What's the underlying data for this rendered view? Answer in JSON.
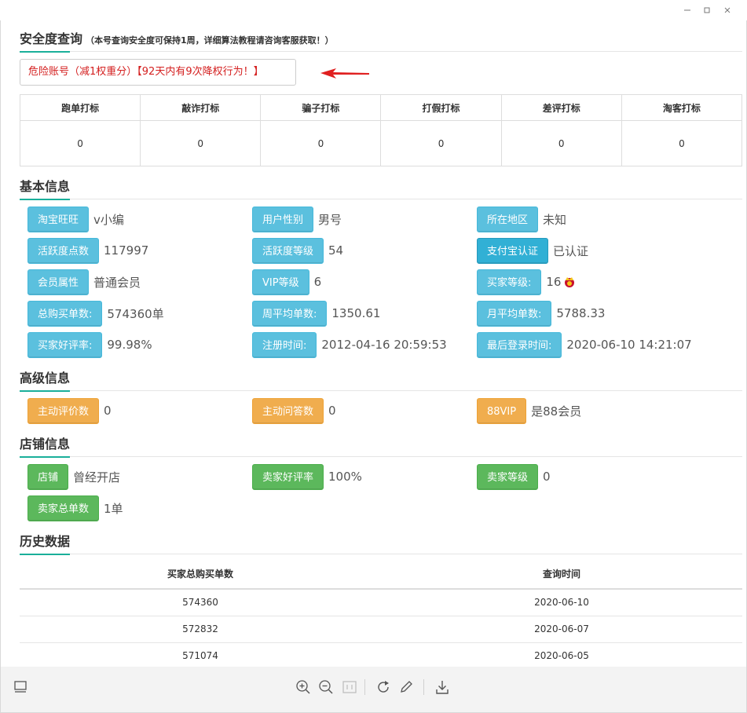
{
  "security": {
    "title": "安全度查询",
    "subtitle": "（本号查询安全度可保持1周，详细算法教程请咨询客服获取！）",
    "alert": "危险账号（减1权重分）【92天内有9次降权行为！】",
    "marks_headers": [
      "跑单打标",
      "敲诈打标",
      "骗子打标",
      "打假打标",
      "差评打标",
      "淘客打标"
    ],
    "marks_values": [
      "0",
      "0",
      "0",
      "0",
      "0",
      "0"
    ]
  },
  "basic": {
    "title": "基本信息",
    "rows": [
      [
        {
          "label": "淘宝旺旺",
          "value": "v小编"
        },
        {
          "label": "用户性别",
          "value": "男号"
        },
        {
          "label": "所在地区",
          "value": "未知"
        }
      ],
      [
        {
          "label": "活跃度点数",
          "value": "117997"
        },
        {
          "label": "活跃度等级",
          "value": "54"
        },
        {
          "label": "支付宝认证",
          "value": "已认证"
        }
      ],
      [
        {
          "label": "会员属性",
          "value": "普通会员"
        },
        {
          "label": "VIP等级",
          "value": "6"
        },
        {
          "label": "买家等级:",
          "value": "16"
        }
      ],
      [
        {
          "label": "总购买单数:",
          "value": "574360单"
        },
        {
          "label": "周平均单数:",
          "value": "1350.61"
        },
        {
          "label": "月平均单数:",
          "value": "5788.33"
        }
      ],
      [
        {
          "label": "买家好评率:",
          "value": "99.98%"
        },
        {
          "label": "注册时间:",
          "value": "2012-04-16 20:59:53"
        },
        {
          "label": "最后登录时间:",
          "value": "2020-06-10 14:21:07"
        }
      ]
    ]
  },
  "advanced": {
    "title": "高级信息",
    "items": [
      {
        "label": "主动评价数",
        "value": "0"
      },
      {
        "label": "主动问答数",
        "value": "0"
      },
      {
        "label": "88VIP",
        "value": "是88会员"
      }
    ]
  },
  "shop": {
    "title": "店铺信息",
    "row1": [
      {
        "label": "店铺",
        "value": "曾经开店"
      },
      {
        "label": "卖家好评率",
        "value": "100%"
      },
      {
        "label": "卖家等级",
        "value": "0"
      }
    ],
    "row2": [
      {
        "label": "卖家总单数",
        "value": "1单"
      }
    ]
  },
  "history": {
    "title": "历史数据",
    "headers": [
      "买家总购买单数",
      "查询时间"
    ],
    "rows": [
      [
        "574360",
        "2020-06-10"
      ],
      [
        "572832",
        "2020-06-07"
      ],
      [
        "571074",
        "2020-06-05"
      ]
    ]
  },
  "colors": {
    "accent": "#1aaf9a",
    "alert": "#d42020",
    "info": "#5bc0de",
    "warning": "#f0ad4e",
    "success": "#5cb85c"
  },
  "toolbar_icons": [
    "screen-icon",
    "zoom-in-icon",
    "zoom-out-icon",
    "actual-size-icon",
    "rotate-icon",
    "edit-icon",
    "download-icon"
  ]
}
